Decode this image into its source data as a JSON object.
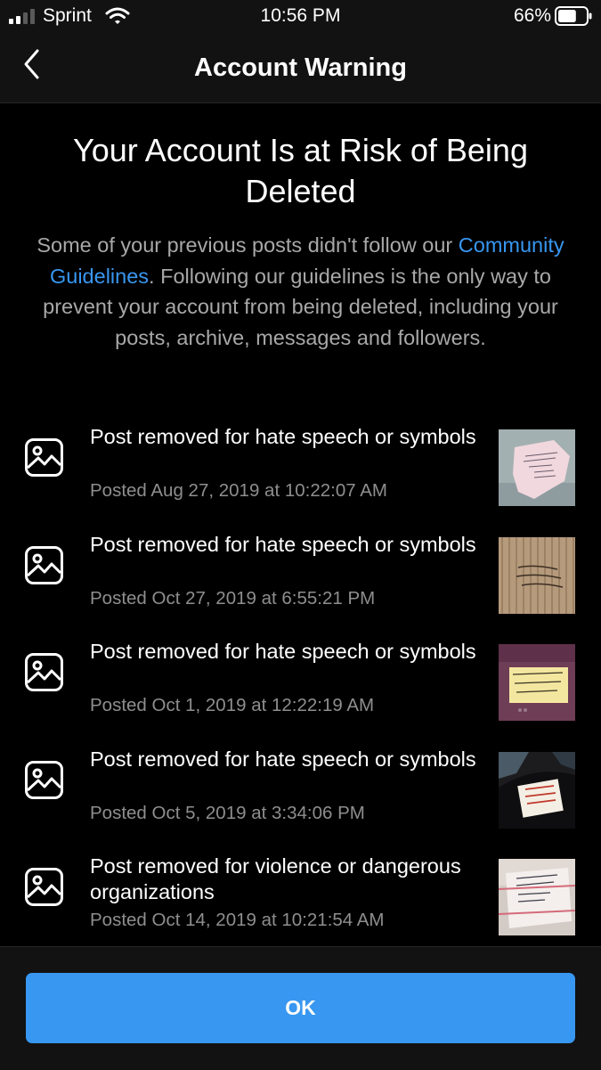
{
  "status_bar": {
    "carrier": "Sprint",
    "time": "10:56 PM",
    "battery": "66%",
    "battery_level": 0.66
  },
  "nav": {
    "title": "Account Warning",
    "back_icon": "chevron-left-icon"
  },
  "warning": {
    "heading": "Your Account Is at Risk of Being Deleted",
    "desc_before": "Some of your previous posts didn't follow our ",
    "desc_link": "Community Guidelines",
    "desc_after": ". Following our guidelines is the only way to prevent your account from being deleted, including your posts, archive, messages and followers."
  },
  "posts": [
    {
      "title": "Post removed for hate speech or symbols",
      "date": "Posted Aug 27, 2019 at 10:22:07 AM",
      "icon": "image-icon",
      "thumb_note": "August 26, 2019 I do not consent to this presidency."
    },
    {
      "title": "Post removed for hate speech or symbols",
      "date": "Posted Oct 27, 2019 at 6:55:21 PM",
      "icon": "image-icon",
      "thumb_note": "October 26, 2019 I do not consent to this presidency."
    },
    {
      "title": "Post removed for hate speech or symbols",
      "date": "Posted Oct 1, 2019 at 12:22:19 AM",
      "icon": "image-icon",
      "thumb_note": "September 30, 2019 I do not consent to this presidency."
    },
    {
      "title": "Post removed for hate speech or symbols",
      "date": "Posted Oct 5, 2019 at 3:34:06 PM",
      "icon": "image-icon",
      "thumb_note": "October 4, 2019 I do not consent to this presidency."
    },
    {
      "title": "Post removed for violence or dangerous organizations",
      "date": "Posted Oct 14, 2019 at 10:21:54 AM",
      "icon": "image-icon",
      "thumb_note": "October 13, 2019 I do not consent to this presidency."
    }
  ],
  "footer": {
    "ok_label": "OK"
  },
  "colors": {
    "accent": "#3897f0",
    "background": "#000000",
    "bar": "#121212",
    "secondary_text": "#a8a8a8",
    "muted_text": "#8e8e8e"
  }
}
